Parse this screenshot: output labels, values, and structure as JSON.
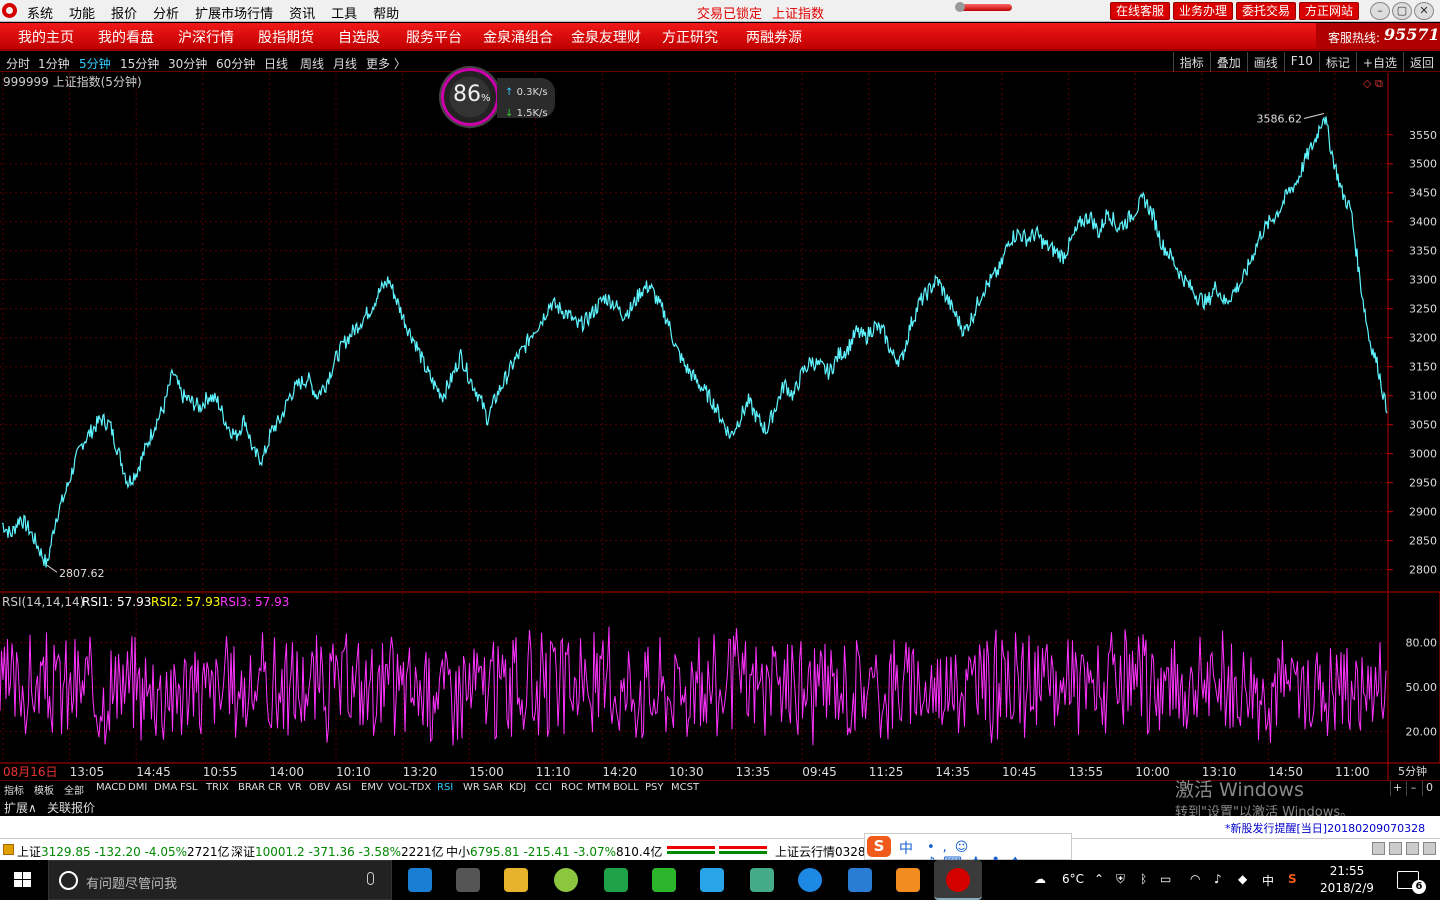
{
  "menubar": {
    "items": [
      "系统",
      "功能",
      "报价",
      "分析",
      "扩展市场行情",
      "资讯",
      "工具",
      "帮助"
    ],
    "status_locked": "交易已锁定",
    "status_index": "上证指数",
    "red_buttons": [
      "在线客服",
      "业务办理",
      "委托交易",
      "方正网站"
    ],
    "win_buttons": [
      "–",
      "▢",
      "✕"
    ]
  },
  "nav": {
    "items": [
      "我的主页",
      "我的看盘",
      "沪深行情",
      "股指期货",
      "自选股",
      "服务平台",
      "金泉涌组合",
      "金泉友理财",
      "方正研究",
      "两融券源"
    ],
    "hotline_label": "客服热线:",
    "hotline_number": "95571"
  },
  "toolbar": {
    "periods": [
      "分时",
      "1分钟",
      "5分钟",
      "15分钟",
      "30分钟",
      "60分钟",
      "日线",
      "周线",
      "月线",
      "更多 〉"
    ],
    "active_period": "5分钟",
    "tools": [
      "指标",
      "叠加",
      "画线",
      "F10",
      "标记",
      "+自选",
      "返回"
    ]
  },
  "speed": {
    "percent": "86",
    "percent_unit": "%",
    "up_rate": "0.3",
    "down_rate": "1.5",
    "rate_unit": "K/s"
  },
  "chart_data": [
    {
      "type": "line",
      "title": "999999 上证指数(5分钟)",
      "series": [
        {
          "values": [
            2880,
            2860,
            2890,
            2870,
            2840,
            2807.62,
            2890,
            2930,
            2980,
            3020,
            3040,
            3060,
            3050,
            3000,
            2950,
            2970,
            3010,
            3050,
            3080,
            3140,
            3100,
            3090,
            3080,
            3100,
            3090,
            3050,
            3030,
            3060,
            3000,
            2990,
            3040,
            3060,
            3100,
            3120,
            3130,
            3100,
            3120,
            3160,
            3190,
            3210,
            3230,
            3250,
            3280,
            3300,
            3260,
            3220,
            3190,
            3150,
            3120,
            3100,
            3130,
            3170,
            3130,
            3100,
            3060,
            3100,
            3130,
            3160,
            3180,
            3210,
            3230,
            3260,
            3250,
            3240,
            3220,
            3230,
            3250,
            3270,
            3260,
            3240,
            3250,
            3280,
            3290,
            3260,
            3230,
            3180,
            3150,
            3130,
            3110,
            3090,
            3060,
            3030,
            3060,
            3090,
            3060,
            3040,
            3080,
            3120,
            3100,
            3140,
            3160,
            3150,
            3140,
            3170,
            3180,
            3210,
            3200,
            3220,
            3210,
            3170,
            3160,
            3220,
            3260,
            3280,
            3300,
            3270,
            3240,
            3210,
            3240,
            3280,
            3300,
            3320,
            3370,
            3380,
            3370,
            3380,
            3360,
            3350,
            3340,
            3370,
            3400,
            3410,
            3380,
            3420,
            3390,
            3400,
            3420,
            3440,
            3410,
            3360,
            3340,
            3310,
            3290,
            3270,
            3260,
            3290,
            3260,
            3280,
            3300,
            3340,
            3380,
            3400,
            3420,
            3450,
            3470,
            3510,
            3540,
            3586.62,
            3510,
            3450,
            3420,
            3300,
            3200,
            3150,
            3070
          ]
        }
      ],
      "x_labels": [
        "08月16日",
        "13:05",
        "14:45",
        "10:55",
        "14:00",
        "10:10",
        "13:20",
        "15:00",
        "11:10",
        "14:20",
        "10:30",
        "13:35",
        "09:45",
        "11:25",
        "14:35",
        "10:45",
        "13:55",
        "10:00",
        "13:10",
        "14:50",
        "11:00"
      ],
      "y_ticks": [
        3550,
        3500,
        3450,
        3400,
        3350,
        3300,
        3250,
        3200,
        3150,
        3100,
        3050,
        3000,
        2950,
        2900,
        2850,
        2800
      ],
      "ylim": [
        2777,
        3622
      ],
      "annotations": {
        "high": "3586.62",
        "low": "2807.62"
      },
      "period_label": "5分钟",
      "color": "#5ff5ff",
      "grid": true
    },
    {
      "type": "line",
      "name": "RSI(14,14,14)",
      "legend": [
        {
          "label": "RSI1: 57.93",
          "color": "#ffffff"
        },
        {
          "label": "RSI2: 57.93",
          "color": "#ffff00"
        },
        {
          "label": "RSI3: 57.93",
          "color": "#ff33ff"
        }
      ],
      "y_ticks": [
        "80.00",
        "50.00",
        "20.00"
      ],
      "ylim": [
        0,
        100
      ],
      "series": [
        {
          "name": "RSI3",
          "values": [
            57.93
          ]
        }
      ],
      "color": "#ff33ff"
    }
  ],
  "index_tabs": {
    "items": [
      "指标",
      "模板",
      "全部",
      "MACD",
      "DMI",
      "DMA",
      "FSL",
      "TRIX",
      "BRAR",
      "CR",
      "VR",
      "OBV",
      "ASI",
      "EMV",
      "VOL-TDX",
      "RSI",
      "WR",
      "SAR",
      "KDJ",
      "CCI",
      "ROC",
      "MTM",
      "BOLL",
      "PSY",
      "MCST"
    ],
    "active": "RSI",
    "controls": [
      "+",
      "–",
      "0"
    ]
  },
  "ext_tabs": [
    "扩展∧",
    "关联报价"
  ],
  "watermark": {
    "line1": "激活 Windows",
    "line2": "转到\"设置\"以激活 Windows。"
  },
  "news": "*新股发行提醒[当日]20180209070328",
  "status": {
    "sh_label": "上证",
    "sh_value": "3129.85 -132.20 -4.05%",
    "sh_amount": "2721亿",
    "sz_label": "深证",
    "sz_value": "10001.2 -371.36 -3.58%",
    "sz_amount": "2221亿",
    "zx_label": "中小",
    "zx_value": "6795.81 -215.41 -3.07%",
    "zx_amount": "810.4亿",
    "cloud": "上证云行情0328"
  },
  "sogou": {
    "logo": "S",
    "mode": "中",
    "tools": "•,☺♪⌨♟♣♠"
  },
  "taskbar": {
    "search_placeholder": "有问题尽管问我",
    "weather": "6°C",
    "ime": "中",
    "time": "21:55",
    "date": "2018/2/9",
    "notifications": "6"
  }
}
